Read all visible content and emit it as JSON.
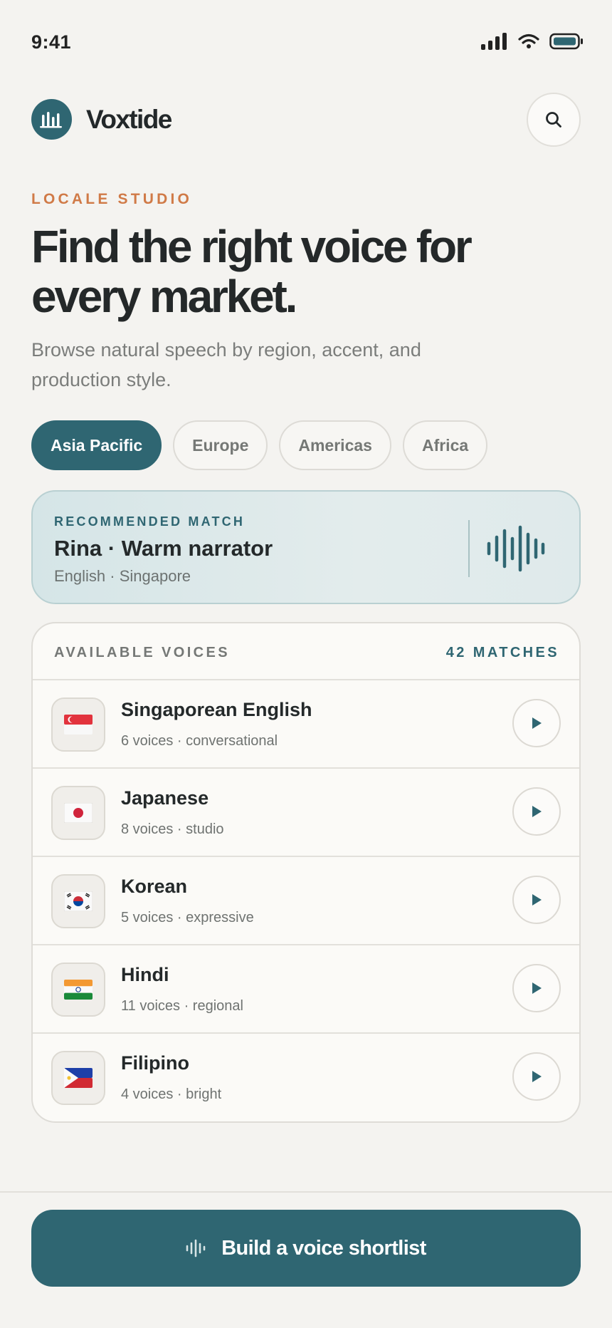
{
  "status": {
    "time": "9:41"
  },
  "brand": {
    "name": "Voxtide"
  },
  "hero": {
    "eyebrow": "LOCALE STUDIO",
    "title": "Find the right voice for every market.",
    "subtitle": "Browse natural speech by region, accent, and production style."
  },
  "regions": [
    {
      "label": "Asia Pacific",
      "active": true
    },
    {
      "label": "Europe",
      "active": false
    },
    {
      "label": "Americas",
      "active": false
    },
    {
      "label": "Africa",
      "active": false
    }
  ],
  "recommended": {
    "eyebrow": "RECOMMENDED MATCH",
    "name": "Rina · Warm narrator",
    "locale": "English · Singapore"
  },
  "voices": {
    "title": "AVAILABLE VOICES",
    "count": "42 MATCHES",
    "items": [
      {
        "name": "Singaporean English",
        "meta": "6 voices · conversational",
        "flag": "flag-singapore-icon"
      },
      {
        "name": "Japanese",
        "meta": "8 voices · studio",
        "flag": "flag-japan-icon"
      },
      {
        "name": "Korean",
        "meta": "5 voices · expressive",
        "flag": "flag-korea-icon"
      },
      {
        "name": "Hindi",
        "meta": "11 voices · regional",
        "flag": "flag-india-icon"
      },
      {
        "name": "Filipino",
        "meta": "4 voices · bright",
        "flag": "flag-philippines-icon"
      }
    ]
  },
  "cta": {
    "label": "Build a voice shortlist"
  },
  "colors": {
    "accent": "#2f6672",
    "eyebrow": "#d07a47",
    "background": "#f4f3f0"
  }
}
